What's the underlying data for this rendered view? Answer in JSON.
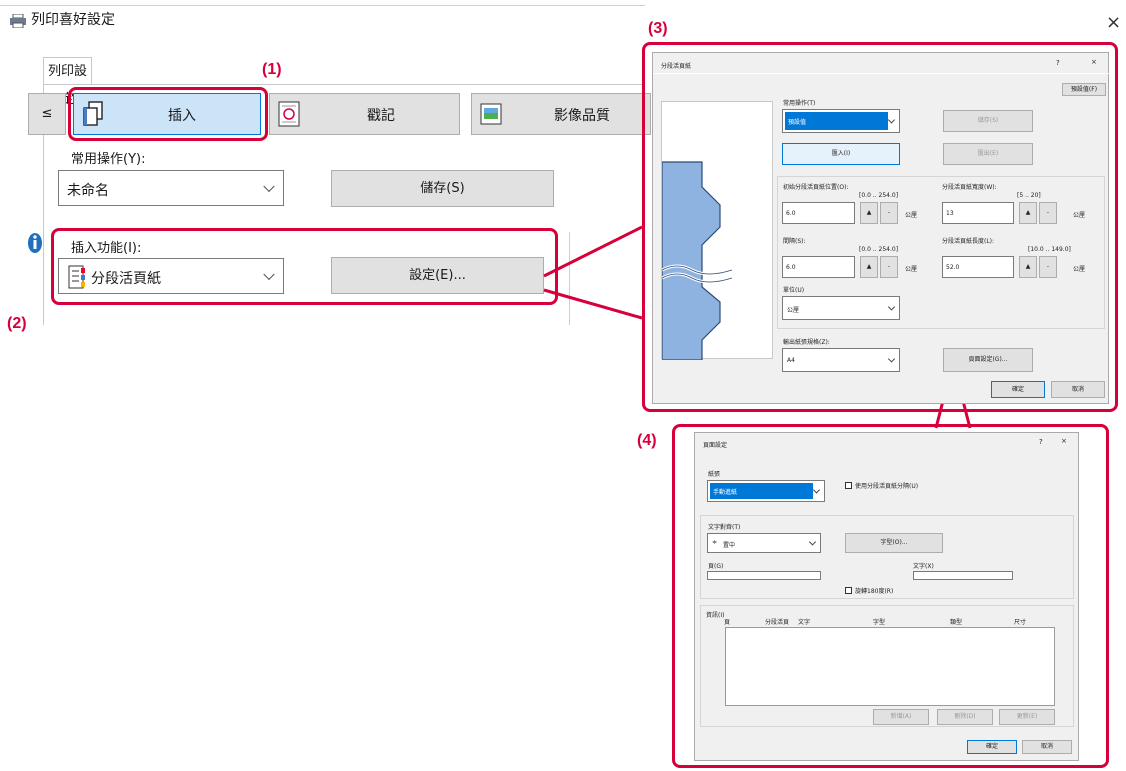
{
  "main_dialog": {
    "title": "列印喜好設定",
    "close_glyph": "×",
    "tab_label": "列印設定",
    "prev_label": "≤",
    "toolbar": {
      "insert_label": "插入",
      "stamp_label": "戳記",
      "image_quality_label": "影像品質"
    },
    "common_ops_label": "常用操作(Y):",
    "common_ops_value": "未命名",
    "save_label": "儲存(S)",
    "insert_func_label": "插入功能(I):",
    "insert_func_value": "分段活頁紙",
    "settings_label": "設定(E)..."
  },
  "callouts": {
    "c1": "(1)",
    "c2": "(2)",
    "c3": "(3)",
    "c4": "(4)"
  },
  "tab_dialog": {
    "title": "分段活頁紙",
    "help_glyph": "?",
    "close_glyph": "×",
    "defaults_label": "預設值(F)",
    "common_ops_label": "常用操作(T)",
    "common_ops_value": "預設值",
    "save_label": "儲存(S)",
    "import_label": "匯入(I)",
    "export_label": "匯出(E)",
    "initial_pos_label": "初始分段活頁紙位置(O):",
    "initial_pos_range": "[0.0 .. 254.0]",
    "initial_pos_value": "6.0",
    "tab_width_label": "分段活頁紙寬度(W):",
    "tab_width_range": "[5 .. 20]",
    "tab_width_value": "13",
    "interval_label": "間隔(S):",
    "interval_range": "[0.0 .. 254.0]",
    "interval_value": "6.0",
    "tab_length_label": "分段活頁紙長度(L):",
    "tab_length_range": "[10.0 .. 149.0]",
    "tab_length_value": "52.0",
    "unit_mm": "公厘",
    "unit_label": "單位(U)",
    "unit_value": "公厘",
    "output_size_label": "輸出紙張規格(Z):",
    "output_size_value": "A4",
    "page_setup_label": "頁面設定(G)...",
    "ok_label": "確定",
    "cancel_label": "取消",
    "spin_up": "▲",
    "spin_down": "-"
  },
  "page_dialog": {
    "title": "頁面設定",
    "help_glyph": "?",
    "close_glyph": "×",
    "paper_label": "紙張",
    "paper_value": "手動進紙",
    "use_tab_paper_label": "使用分段活頁紙分隔(U)",
    "text_align_label": "文字對齊(T)",
    "text_align_value": "置中",
    "font_label": "字型(O)...",
    "page_label": "頁(G)",
    "text_label": "文字(X)",
    "rotate_label": "旋轉180度(R)",
    "info_label": "資訊(I)",
    "columns": [
      "頁",
      "分段活頁",
      "文字",
      "字型",
      "類型",
      "尺寸"
    ],
    "add_label": "新增(A)",
    "delete_label": "刪除(D)",
    "update_label": "更新(E)",
    "ok_label": "確定",
    "cancel_label": "取消"
  },
  "colors": {
    "accent_red": "#d7003a",
    "selected_blue": "#cce4f7",
    "highlight_blue": "#0078d7",
    "tab_shape_blue": "#8fb3e0"
  }
}
